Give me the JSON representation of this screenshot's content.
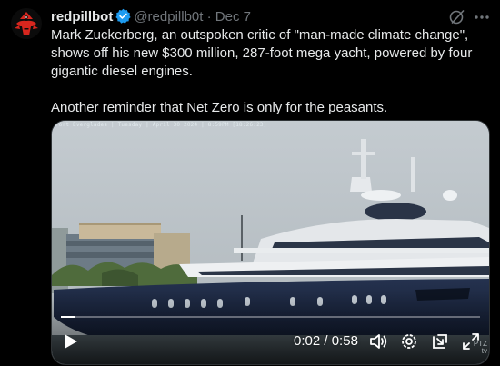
{
  "tweet": {
    "display_name": "redpillbot",
    "handle": "@redpillb0t",
    "separator": "·",
    "date": "Dec 7",
    "text_paragraph_1": "Mark Zuckerberg, an outspoken critic of \"man-made climate change\", shows off his new $300 million, 287-foot mega yacht, powered by four gigantic diesel engines.",
    "text_paragraph_2": "Another reminder that Net Zero is only for the peasants.",
    "verified_badge_color": "#1d9bf0"
  },
  "video": {
    "overlay_stamp": "Port Everglades | Tuesday | April 30 2024 | 8:59PM [18:26:23]",
    "watermark_line_1": "PTZ",
    "watermark_line_2": "tv",
    "current_time": "0:02",
    "duration_separator": "/",
    "duration": "0:58",
    "progress": 0.035,
    "controls": [
      "play-icon",
      "volume-icon",
      "settings-gear-icon",
      "picture-in-picture-icon",
      "fullscreen-icon"
    ]
  },
  "colors": {
    "background": "#000000",
    "text_primary": "#e7e9ea",
    "text_secondary": "#71767b",
    "avatar_red": "#d7261e"
  }
}
